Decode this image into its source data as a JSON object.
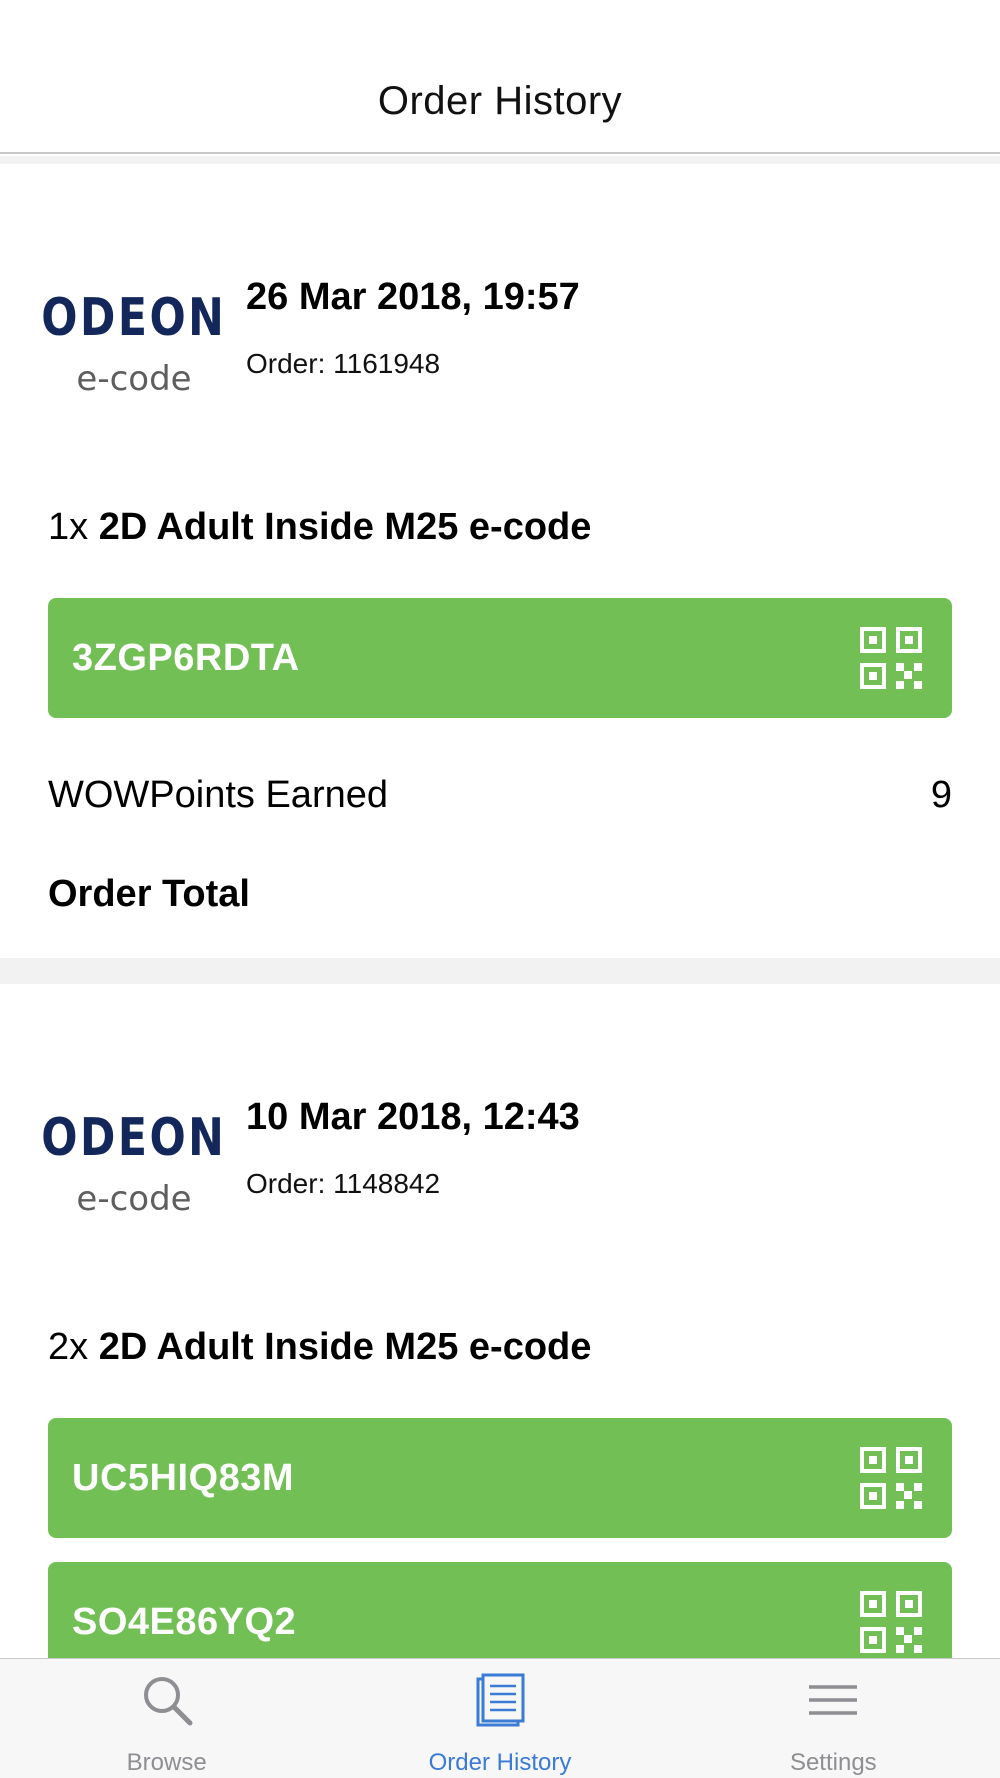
{
  "header": {
    "title": "Order History"
  },
  "orders": [
    {
      "logo": {
        "brand": "ODEON",
        "sub": "e-code"
      },
      "date": "26 Mar 2018, 19:57",
      "order_number": "Order: 1161948",
      "item": {
        "qty": "1x",
        "name": "2D Adult Inside M25 e-code"
      },
      "codes": [
        "3ZGP6RDTA"
      ],
      "points_label": "WOWPoints Earned",
      "points_value": "9",
      "total_label": "Order Total"
    },
    {
      "logo": {
        "brand": "ODEON",
        "sub": "e-code"
      },
      "date": "10 Mar 2018, 12:43",
      "order_number": "Order: 1148842",
      "item": {
        "qty": "2x",
        "name": "2D Adult Inside M25 e-code"
      },
      "codes": [
        "UC5HIQ83M",
        "SO4E86YQ2"
      ]
    }
  ],
  "tabbar": {
    "items": [
      {
        "label": "Browse",
        "icon": "search-icon"
      },
      {
        "label": "Order History",
        "icon": "document-icon",
        "active": true
      },
      {
        "label": "Settings",
        "icon": "menu-icon"
      }
    ]
  },
  "colors": {
    "code_button": "#72bf56",
    "logo_blue": "#13275a",
    "active_tab": "#3a7bd5",
    "inactive_tab": "#8e8e93"
  }
}
